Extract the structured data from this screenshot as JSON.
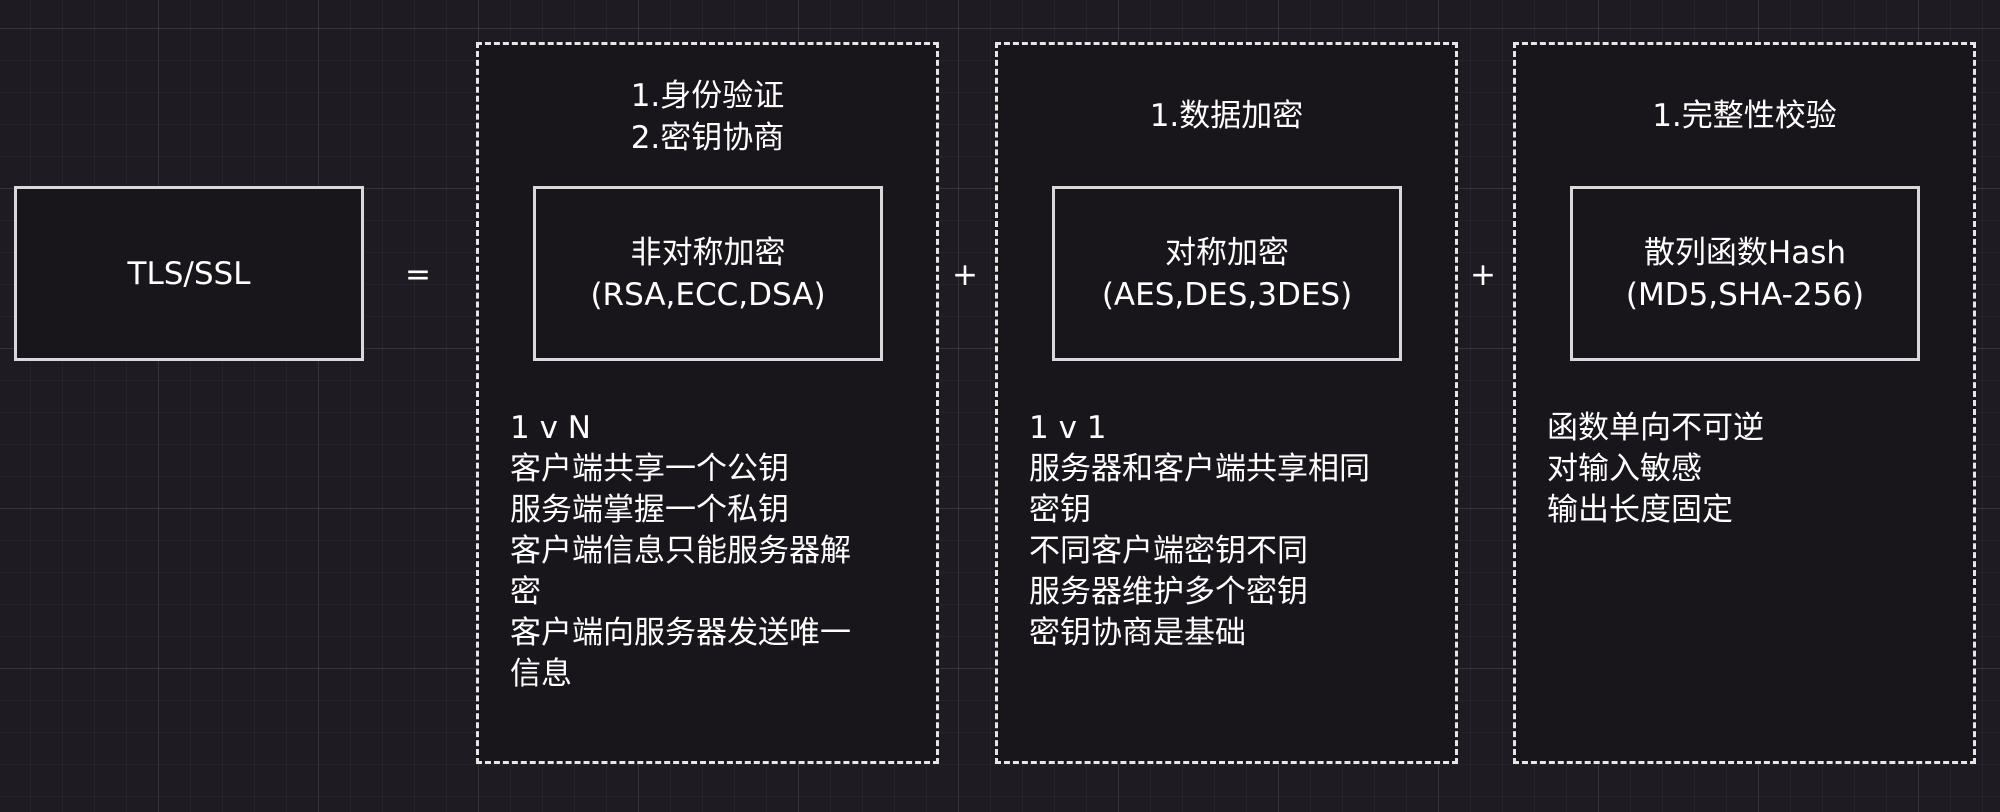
{
  "protocol": {
    "label": "TLS/SSL"
  },
  "operators": {
    "equals": "=",
    "plus_1": "+",
    "plus_2": "+"
  },
  "panels": [
    {
      "headings": [
        "1.身份验证",
        "2.密钥协商"
      ],
      "box_line_1": "非对称加密",
      "box_line_2": "(RSA,ECC,DSA)",
      "notes": [
        "1 v N",
        "客户端共享一个公钥",
        "服务端掌握一个私钥",
        "客户端信息只能服务器解",
        "密",
        "客户端向服务器发送唯一",
        "信息"
      ]
    },
    {
      "headings": [
        "1.数据加密"
      ],
      "box_line_1": "对称加密",
      "box_line_2": "(AES,DES,3DES)",
      "notes": [
        "1 v 1",
        "服务器和客户端共享相同",
        "密钥",
        "不同客户端密钥不同",
        "服务器维护多个密钥",
        "密钥协商是基础"
      ]
    },
    {
      "headings": [
        "1.完整性校验"
      ],
      "box_line_1": "散列函数Hash",
      "box_line_2": "(MD5,SHA-256)",
      "notes": [
        "函数单向不可逆",
        "对输入敏感",
        "输出长度固定"
      ]
    }
  ]
}
